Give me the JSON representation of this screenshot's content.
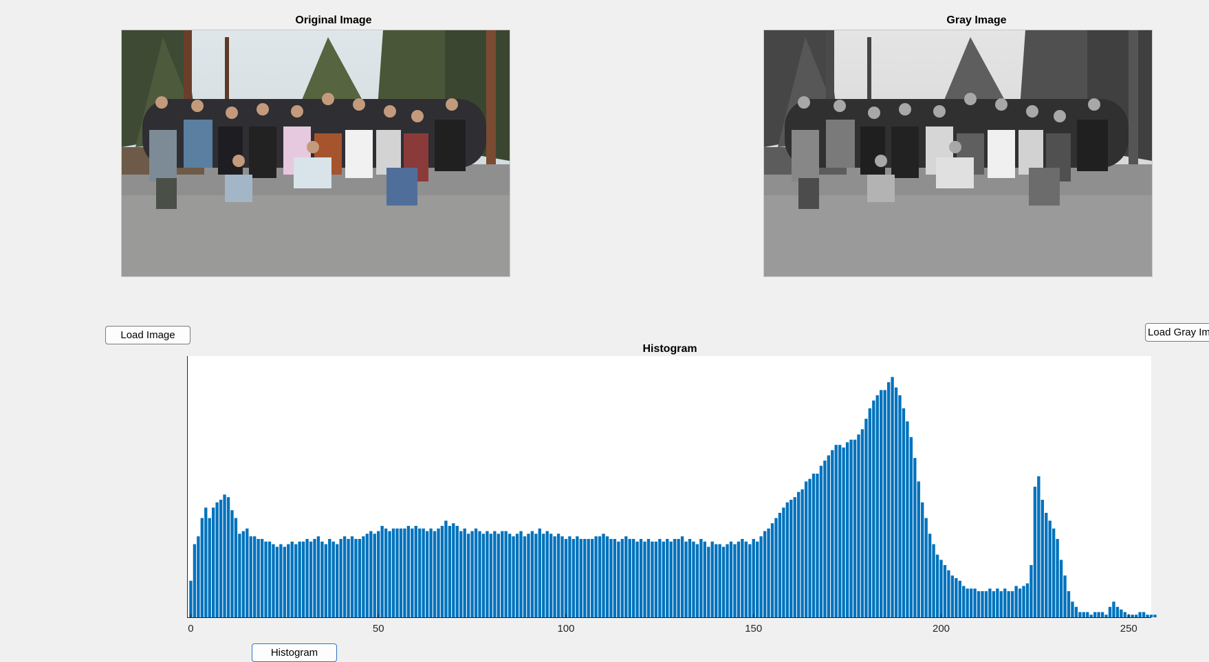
{
  "original_panel": {
    "title": "Original Image"
  },
  "gray_panel": {
    "title": "Gray Image"
  },
  "buttons": {
    "load_image": "Load Image",
    "load_gray": "Load Gray Image",
    "histogram": "Histogram"
  },
  "colors": {
    "bar": "#0072bd",
    "background": "#f0f0f0"
  },
  "chart_data": {
    "type": "bar",
    "title": "Histogram",
    "xlabel": "",
    "ylabel": "",
    "xlim": [
      -1,
      256
    ],
    "ylim": [
      0,
      1
    ],
    "x_ticks": [
      0,
      50,
      100,
      150,
      200,
      250
    ],
    "y_axis_visible": false,
    "grid": false,
    "values_note_units": "relative frequency (normalized to axis max)",
    "x": "0..255",
    "values": [
      0.14,
      0.28,
      0.31,
      0.38,
      0.42,
      0.38,
      0.42,
      0.44,
      0.45,
      0.47,
      0.46,
      0.41,
      0.38,
      0.32,
      0.33,
      0.34,
      0.31,
      0.31,
      0.3,
      0.3,
      0.29,
      0.29,
      0.28,
      0.27,
      0.28,
      0.27,
      0.28,
      0.29,
      0.28,
      0.29,
      0.29,
      0.3,
      0.29,
      0.3,
      0.31,
      0.29,
      0.28,
      0.3,
      0.29,
      0.28,
      0.3,
      0.31,
      0.3,
      0.31,
      0.3,
      0.3,
      0.31,
      0.32,
      0.33,
      0.32,
      0.33,
      0.35,
      0.34,
      0.33,
      0.34,
      0.34,
      0.34,
      0.34,
      0.35,
      0.34,
      0.35,
      0.34,
      0.34,
      0.33,
      0.34,
      0.33,
      0.34,
      0.35,
      0.37,
      0.35,
      0.36,
      0.35,
      0.33,
      0.34,
      0.32,
      0.33,
      0.34,
      0.33,
      0.32,
      0.33,
      0.32,
      0.33,
      0.32,
      0.33,
      0.33,
      0.32,
      0.31,
      0.32,
      0.33,
      0.31,
      0.32,
      0.33,
      0.32,
      0.34,
      0.32,
      0.33,
      0.32,
      0.31,
      0.32,
      0.31,
      0.3,
      0.31,
      0.3,
      0.31,
      0.3,
      0.3,
      0.3,
      0.3,
      0.31,
      0.31,
      0.32,
      0.31,
      0.3,
      0.3,
      0.29,
      0.3,
      0.31,
      0.3,
      0.3,
      0.29,
      0.3,
      0.29,
      0.3,
      0.29,
      0.29,
      0.3,
      0.29,
      0.3,
      0.29,
      0.3,
      0.3,
      0.31,
      0.29,
      0.3,
      0.29,
      0.28,
      0.3,
      0.29,
      0.27,
      0.29,
      0.28,
      0.28,
      0.27,
      0.28,
      0.29,
      0.28,
      0.29,
      0.3,
      0.29,
      0.28,
      0.3,
      0.29,
      0.31,
      0.33,
      0.34,
      0.36,
      0.38,
      0.4,
      0.42,
      0.44,
      0.45,
      0.46,
      0.48,
      0.49,
      0.52,
      0.53,
      0.55,
      0.55,
      0.58,
      0.6,
      0.62,
      0.64,
      0.66,
      0.66,
      0.65,
      0.67,
      0.68,
      0.68,
      0.7,
      0.72,
      0.76,
      0.8,
      0.83,
      0.85,
      0.87,
      0.87,
      0.9,
      0.92,
      0.88,
      0.85,
      0.8,
      0.75,
      0.69,
      0.61,
      0.52,
      0.44,
      0.38,
      0.32,
      0.28,
      0.24,
      0.22,
      0.2,
      0.18,
      0.16,
      0.15,
      0.14,
      0.12,
      0.11,
      0.11,
      0.11,
      0.1,
      0.1,
      0.1,
      0.11,
      0.1,
      0.11,
      0.1,
      0.11,
      0.1,
      0.1,
      0.12,
      0.11,
      0.12,
      0.13,
      0.2,
      0.5,
      0.54,
      0.45,
      0.4,
      0.37,
      0.34,
      0.3,
      0.22,
      0.16,
      0.1,
      0.06,
      0.04,
      0.02,
      0.02,
      0.02,
      0.01,
      0.02,
      0.02,
      0.02,
      0.01,
      0.04,
      0.06,
      0.04,
      0.03,
      0.02,
      0.01,
      0.01,
      0.01,
      0.02,
      0.02,
      0.01,
      0.01,
      0.01
    ]
  }
}
